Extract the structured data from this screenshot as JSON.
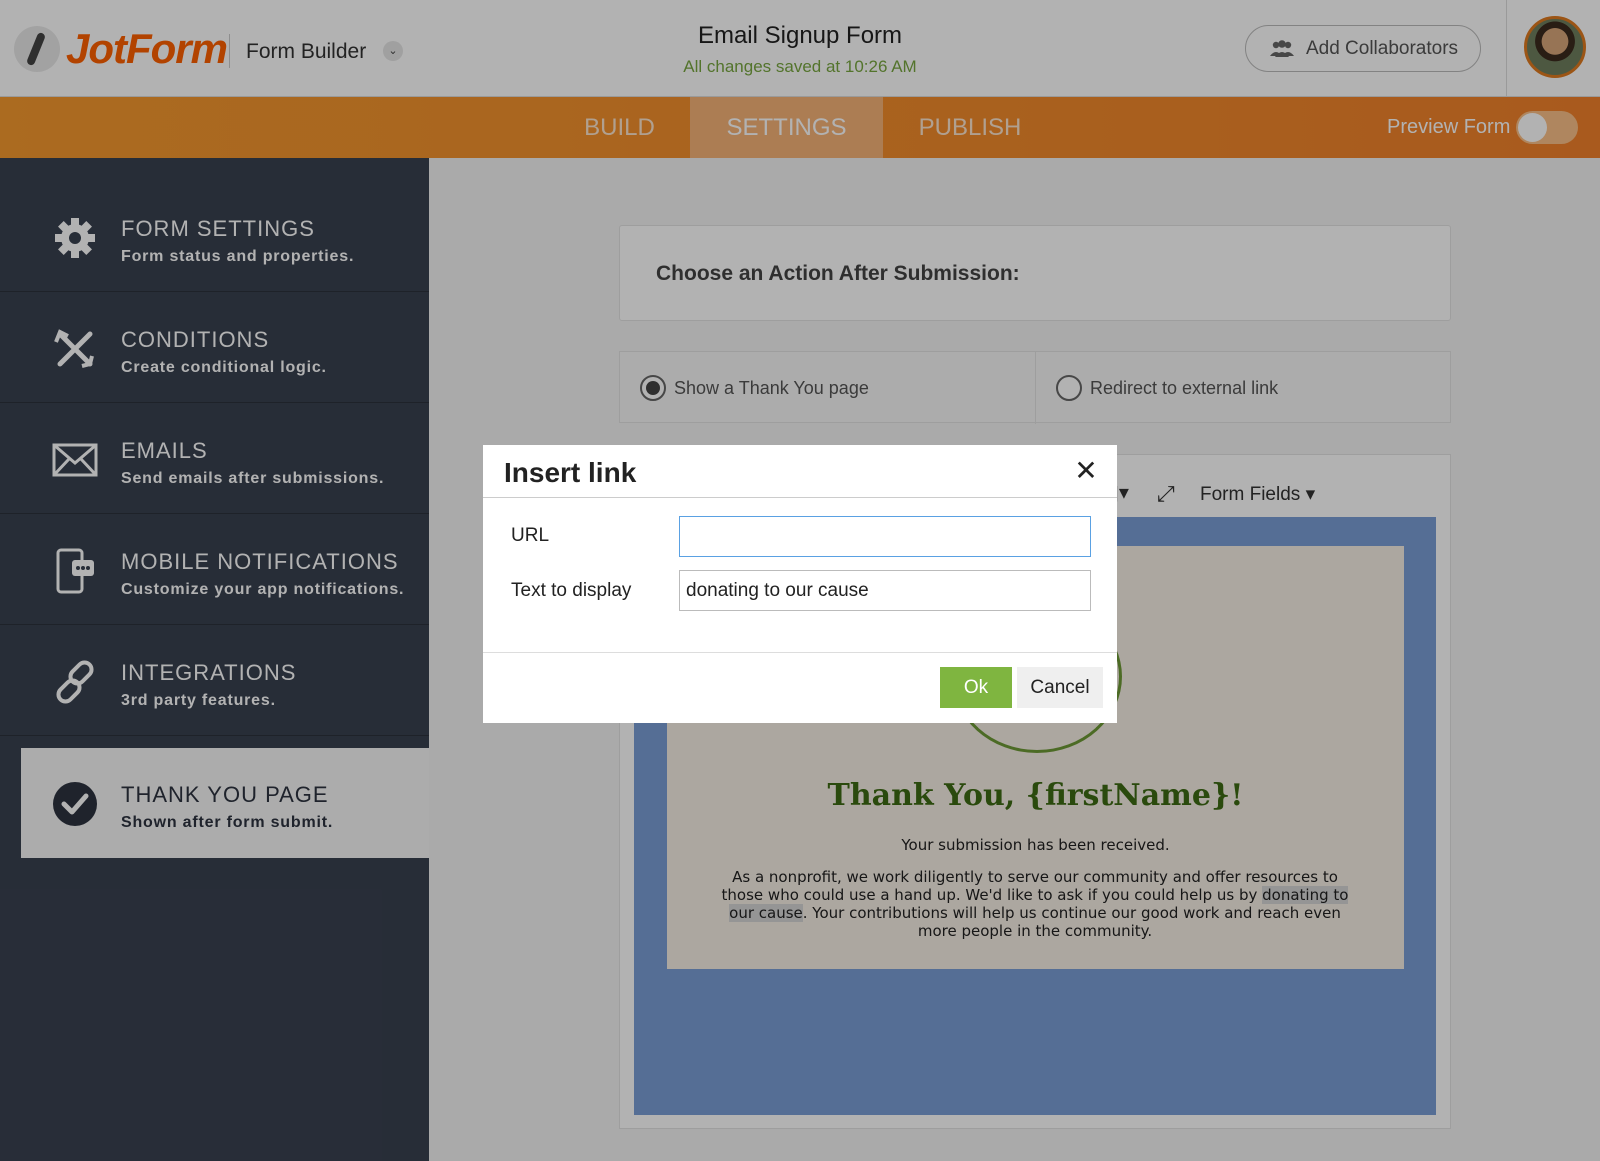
{
  "header": {
    "logo_text": "JotForm",
    "app_section": "Form Builder",
    "form_title": "Email Signup Form",
    "save_status": "All changes saved at 10:26 AM",
    "add_collaborators_label": "Add Collaborators"
  },
  "nav": {
    "tabs": [
      {
        "label": "BUILD"
      },
      {
        "label": "SETTINGS",
        "active": true
      },
      {
        "label": "PUBLISH"
      }
    ],
    "preview_label": "Preview Form"
  },
  "sidebar": {
    "items": [
      {
        "title": "FORM SETTINGS",
        "subtitle": "Form status and properties.",
        "icon": "gear-icon"
      },
      {
        "title": "CONDITIONS",
        "subtitle": "Create conditional logic.",
        "icon": "conditions-icon"
      },
      {
        "title": "EMAILS",
        "subtitle": "Send emails after submissions.",
        "icon": "envelope-icon"
      },
      {
        "title": "MOBILE NOTIFICATIONS",
        "subtitle": "Customize your app notifications.",
        "icon": "mobile-notification-icon"
      },
      {
        "title": "INTEGRATIONS",
        "subtitle": "3rd party features.",
        "icon": "link-icon"
      },
      {
        "title": "THANK YOU PAGE",
        "subtitle": "Shown after form submit.",
        "icon": "checkmark-circle-icon",
        "active": true
      }
    ]
  },
  "main": {
    "choose_action_title": "Choose an Action After Submission:",
    "options": [
      {
        "label": "Show a Thank You page",
        "checked": true
      },
      {
        "label": "Redirect to external link",
        "checked": false
      }
    ],
    "toolbar": {
      "form_fields_label": "Form Fields"
    },
    "thank_you": {
      "heading": "Thank You, {firstName}!",
      "subheading": "Your submission has been received.",
      "body_before": "As a nonprofit, we work diligently to serve our community and offer resources to those who could use a hand up. We'd like to ask if you could help us by ",
      "body_highlight": "donating to our cause",
      "body_after": ". Your contributions will help us continue our good work and reach even more people in the community."
    }
  },
  "modal": {
    "title": "Insert link",
    "url_label": "URL",
    "url_value": "",
    "text_label": "Text to display",
    "text_value": "donating to our cause",
    "ok_label": "Ok",
    "cancel_label": "Cancel"
  },
  "colors": {
    "brand_orange": "#ff6100",
    "sidebar_bg": "#394150",
    "ok_green": "#7fb540",
    "saved_green": "#78a640"
  }
}
